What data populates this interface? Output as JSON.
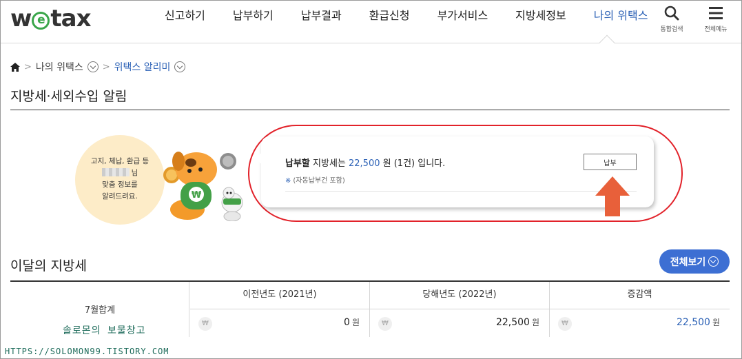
{
  "header": {
    "logo": {
      "w": "w",
      "e": "e",
      "rest": "tax"
    },
    "nav": [
      "신고하기",
      "납부하기",
      "납부결과",
      "환급신청",
      "부가서비스",
      "지방세정보",
      "나의 위택스"
    ],
    "active_index": 6,
    "search_label": "통합검색",
    "menu_label": "전체메뉴"
  },
  "breadcrumb": {
    "level1": "나의 위택스",
    "level2": "위택스 알리미"
  },
  "page_title": "지방세·세외수입 알림",
  "bubble": {
    "line1": "고지, 체납, 환급 등",
    "line2_suffix": "님",
    "line3": "맞춤 정보를",
    "line4": "알려드려요."
  },
  "alert": {
    "prefix": "납부할",
    "mid": " 지방세는 ",
    "amount": "22,500",
    "suffix": " 원 (1건) 입니다.",
    "note_mark": "※",
    "note": "(자동납부건 포함)",
    "pay_button": "납부"
  },
  "monthly": {
    "title": "이달의 지방세",
    "view_all": "전체보기",
    "row_label": "7월합계",
    "columns": [
      {
        "header": "이전년도 (2021년)",
        "value": "0",
        "unit": "원",
        "highlight": false
      },
      {
        "header": "당해년도 (2022년)",
        "value": "22,500",
        "unit": "원",
        "highlight": false
      },
      {
        "header": "증감액",
        "value": "22,500",
        "unit": "원",
        "highlight": true
      }
    ],
    "won_symbol": "₩"
  },
  "watermark": {
    "line1": "솔로몬의 보물창고",
    "line2": "HTTPS://SOLOMON99.TISTORY.COM"
  },
  "colors": {
    "accent": "#2d62b6",
    "button": "#3d6fd3",
    "highlight_oval": "#e2222a",
    "logo_green": "#3aa64a"
  }
}
